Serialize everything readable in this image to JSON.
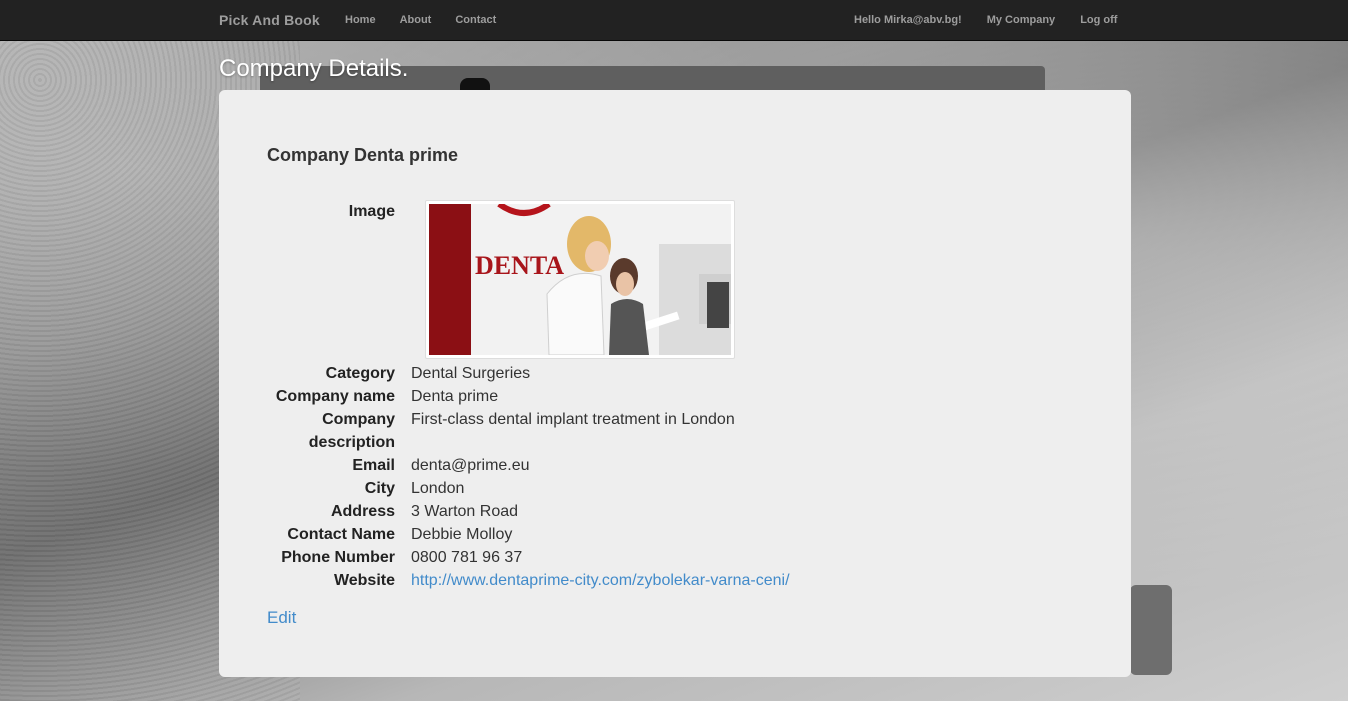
{
  "nav": {
    "brand": "Pick And Book",
    "left": [
      "Home",
      "About",
      "Contact"
    ],
    "user_greeting": "Hello Mirka@abv.bg!",
    "my_company": "My Company",
    "logoff": "Log off"
  },
  "page_title": "Company Details.",
  "company": {
    "heading": "Company Denta prime",
    "labels": {
      "image": "Image",
      "category": "Category",
      "name": "Company name",
      "description": "Company description",
      "email": "Email",
      "city": "City",
      "address": "Address",
      "contact": "Contact Name",
      "phone": "Phone Number",
      "website": "Website"
    },
    "values": {
      "category": "Dental Surgeries",
      "name": "Denta prime",
      "description": "First-class dental implant treatment in London",
      "email": "denta@prime.eu",
      "city": "London",
      "address": "3 Warton Road",
      "contact": "Debbie Molloy",
      "phone": "0800 781 96 37",
      "website": "http://www.dentaprime-city.com/zybolekar-varna-ceni/"
    },
    "image_sign_text": "DENTA",
    "edit_label": "Edit"
  }
}
